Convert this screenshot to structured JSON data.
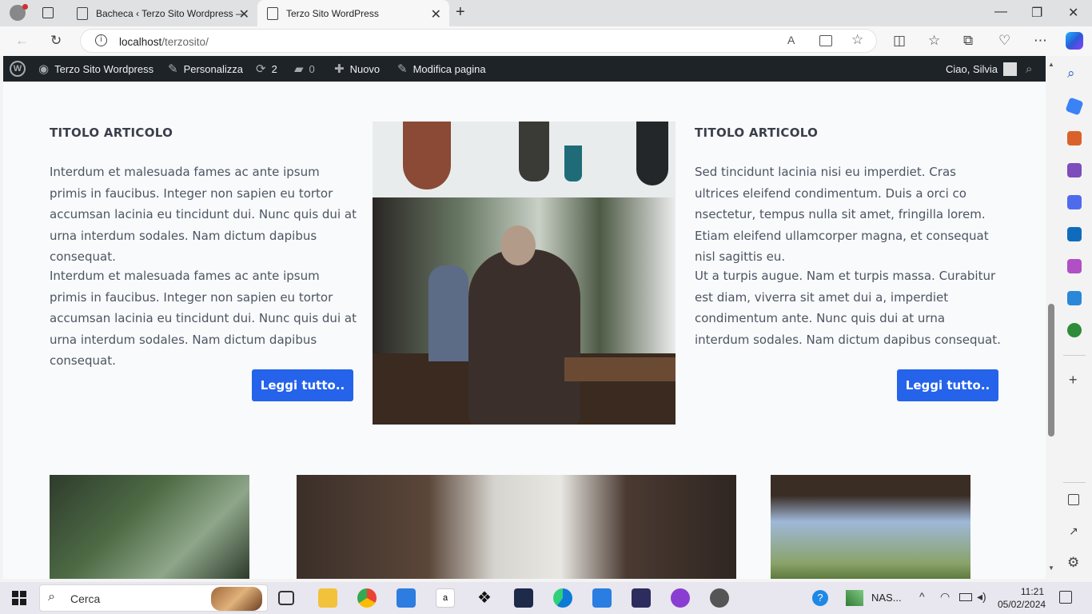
{
  "browser": {
    "tabs": [
      {
        "label": "Bacheca ‹ Terzo Sito Wordpress —"
      },
      {
        "label": "Terzo Sito WordPress"
      }
    ],
    "url_host": "localhost",
    "url_path": "/terzosito/"
  },
  "admin_bar": {
    "site_name": "Terzo Sito Wordpress",
    "customize": "Personalizza",
    "updates_count": "2",
    "comments_count": "0",
    "new_label": "Nuovo",
    "edit_page": "Modifica pagina",
    "greeting": "Ciao, Silvia"
  },
  "articles": [
    {
      "title": "TITOLO ARTICOLO",
      "paragraphs": [
        "Interdum et malesuada fames ac ante ipsum primis in faucibus. Integer non sapien eu tortor accumsan lacinia eu tincidunt dui. Nunc quis dui at urna interdum sodales. Nam dictum dapibus consequat.",
        "Interdum et malesuada fames ac ante ipsum primis in faucibus. Integer non sapien eu tortor accumsan lacinia eu tincidunt dui. Nunc quis dui at urna interdum sodales. Nam dictum dapibus consequat."
      ],
      "button": "Leggi tutto.."
    },
    {
      "title": "TITOLO ARTICOLO",
      "paragraphs": [
        "Sed tincidunt lacinia nisi eu imperdiet. Cras ultrices eleifend condimentum. Duis a orci co nsectetur, tempus nulla sit amet, fringilla lorem. Etiam eleifend ullamcorper magna, et consequat nisl sagittis eu.",
        "Ut a turpis augue. Nam et turpis massa. Curabitur est diam, viverra sit amet dui a, imperdiet condimentum ante. Nunc quis dui at urna interdum sodales. Nam dictum dapibus consequat."
      ],
      "button": "Leggi tutto.."
    }
  ],
  "taskbar": {
    "search_placeholder": "Cerca",
    "tray_label": "NAS...",
    "time": "11:21",
    "date": "05/02/2024"
  }
}
